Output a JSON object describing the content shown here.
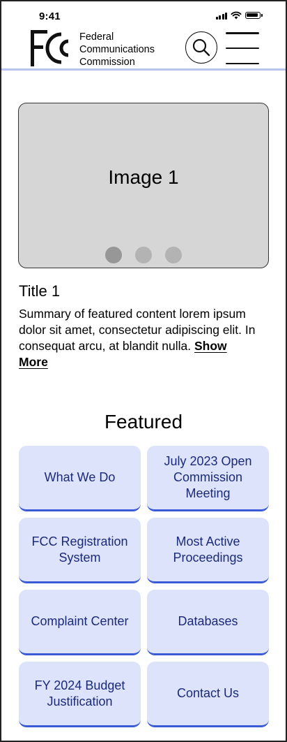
{
  "status_bar": {
    "time": "9:41"
  },
  "header": {
    "agency_lines": [
      "Federal",
      "Communications",
      "Commission"
    ]
  },
  "carousel": {
    "image_label": "Image 1",
    "total_slides": 3,
    "active_slide": 1
  },
  "feature": {
    "title": "Title 1",
    "summary": "Summary of featured content lorem ipsum dolor sit amet, consectetur adipiscing elit. In consequat arcu, at blandit nulla.",
    "show_more_label": "Show More"
  },
  "featured": {
    "heading": "Featured",
    "tiles": [
      "What We Do",
      "July 2023 Open Commission Meeting",
      "FCC Registration System",
      "Most Active Proceedings",
      "Complaint Center",
      "Databases",
      "FY 2024 Budget Justification",
      "Contact Us"
    ]
  },
  "colors": {
    "tile_bg": "#dde3fb",
    "tile_accent": "#3b5bd6",
    "tile_text": "#1a2a78",
    "header_rule": "#b8c4f0",
    "carousel_bg": "#d6d6d6"
  },
  "icons": [
    "signal-icon",
    "wifi-icon",
    "battery-icon",
    "fcc-logo",
    "search-icon",
    "hamburger-menu-icon"
  ]
}
